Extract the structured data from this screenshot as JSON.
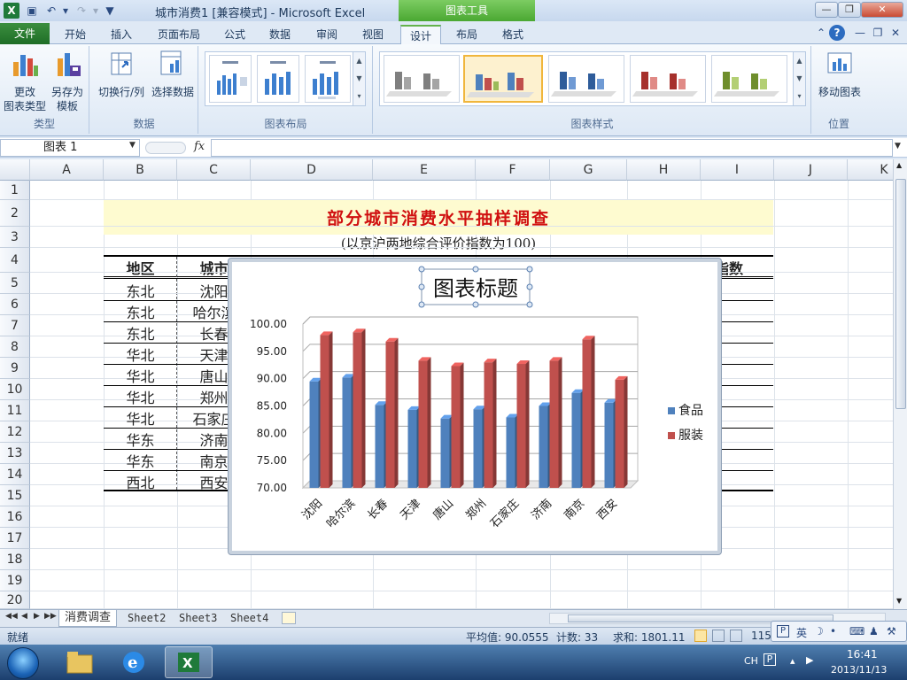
{
  "window": {
    "title": "城市消费1 [兼容模式] - Microsoft Excel",
    "context_tools": "图表工具",
    "logo": "X"
  },
  "tabs": [
    "开始",
    "插入",
    "页面布局",
    "公式",
    "数据",
    "审阅",
    "视图",
    "设计",
    "布局",
    "格式"
  ],
  "file_tab": "文件",
  "ribbon": {
    "type_group": "类型",
    "change_type": [
      "更改",
      "图表类型"
    ],
    "save_template": [
      "另存为",
      "模板"
    ],
    "data_group": "数据",
    "switch_row_col": "切换行/列",
    "select_data": "选择数据",
    "layout_group": "图表布局",
    "styles_group": "图表样式",
    "location_group": "位置",
    "move_chart": "移动图表"
  },
  "formula_bar": {
    "name_box": "图表 1",
    "fx": "fx",
    "formula": ""
  },
  "columns": [
    "A",
    "B",
    "C",
    "D",
    "E",
    "F",
    "G",
    "H",
    "I",
    "J",
    "K"
  ],
  "rows": [
    "1",
    "2",
    "3",
    "4",
    "5",
    "6",
    "7",
    "8",
    "9",
    "10",
    "11",
    "12",
    "13",
    "14",
    "15",
    "16",
    "17",
    "18",
    "19",
    "20"
  ],
  "sheet": {
    "title": "部分城市消费水平抽样调查",
    "subtitle": "(以京沪两地综合评价指数为100)",
    "header_region": "地区",
    "header_city": "城市",
    "header_total": "总指数",
    "regions": [
      "东北",
      "东北",
      "东北",
      "华北",
      "华北",
      "华北",
      "华北",
      "华东",
      "华东",
      "西北"
    ],
    "cities": [
      "沈阳",
      "哈尔滨",
      "长春",
      "天津",
      "唐山",
      "郑州",
      "石家庄",
      "济南",
      "南京",
      "西安"
    ]
  },
  "chart_data": {
    "type": "bar",
    "title": "图表标题",
    "categories": [
      "沈阳",
      "哈尔滨",
      "长春",
      "天津",
      "唐山",
      "郑州",
      "石家庄",
      "济南",
      "南京",
      "西安"
    ],
    "series": [
      {
        "name": "食品",
        "color": "#4f81bd",
        "values": [
          89.5,
          90.2,
          85.2,
          84.3,
          82.7,
          84.4,
          82.9,
          85.0,
          87.4,
          85.6
        ]
      },
      {
        "name": "服装",
        "color": "#c0504d",
        "values": [
          98.0,
          98.5,
          96.8,
          93.3,
          92.3,
          93.0,
          92.7,
          93.3,
          97.2,
          89.8
        ]
      }
    ],
    "ylim": [
      70,
      100
    ],
    "yticks": [
      "70.00",
      "75.00",
      "80.00",
      "85.00",
      "90.00",
      "95.00",
      "100.00"
    ],
    "grid": true,
    "legend": "right",
    "style": "3d-clustered-column"
  },
  "sheet_tabs": [
    "消费调查",
    "Sheet2",
    "Sheet3",
    "Sheet4"
  ],
  "status": {
    "ready": "就绪",
    "average": "平均值: 90.0555",
    "count": "计数: 33",
    "sum": "求和: 1801.11",
    "zoom": "115"
  },
  "ime": {
    "lang": "英"
  },
  "taskbar": {
    "lang": "CH",
    "time": "16:41",
    "date": "2013/11/13"
  }
}
